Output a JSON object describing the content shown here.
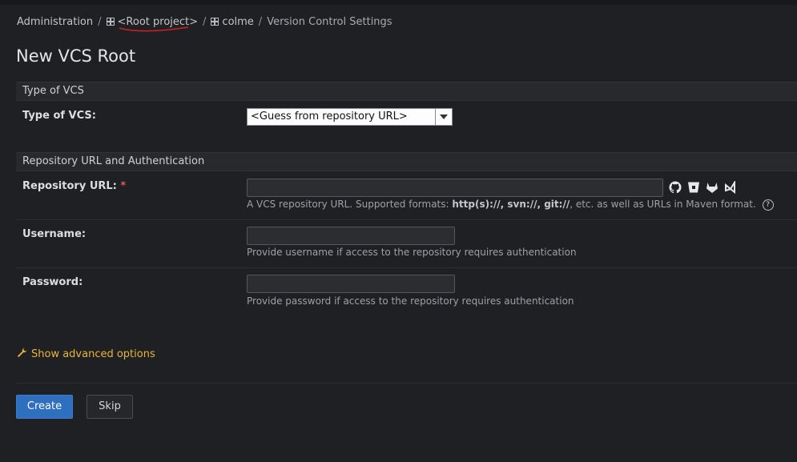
{
  "breadcrumb": {
    "administration": "Administration",
    "separator": "/",
    "root_project": "<Root project>",
    "project": "colme",
    "current": "Version Control Settings"
  },
  "page": {
    "title": "New VCS Root"
  },
  "type_section": {
    "header": "Type of VCS",
    "label": "Type of VCS:",
    "selected": "<Guess from repository URL>"
  },
  "repo_section": {
    "header": "Repository URL and Authentication",
    "url_label": "Repository URL:",
    "required_mark": "*",
    "url_value": "",
    "url_hint_prefix": "A VCS repository URL. Supported formats: ",
    "url_hint_formats": "http(s)://, svn://, git://",
    "url_hint_suffix": ", etc. as well as URLs in Maven format.",
    "help": "?",
    "username_label": "Username:",
    "username_value": "",
    "username_hint": "Provide username if access to the repository requires authentication",
    "password_label": "Password:",
    "password_value": "",
    "password_hint": "Provide password if access to the repository requires authentication"
  },
  "vcs_icons": [
    "github-icon",
    "bitbucket-icon",
    "gitlab-icon",
    "azure-devops-icon"
  ],
  "advanced": {
    "label": "Show advanced options"
  },
  "buttons": {
    "create": "Create",
    "skip": "Skip"
  },
  "colors": {
    "accent": "#e8b53a",
    "primary": "#2f6fbf",
    "required": "#e05555"
  }
}
